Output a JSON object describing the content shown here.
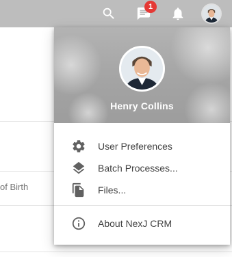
{
  "topbar": {
    "icons": [
      "search-icon",
      "chat-icon",
      "bell-icon"
    ],
    "notification_count": "1",
    "bg_color": "#bdbdbd",
    "badge_color": "#e53935"
  },
  "background": {
    "column_label": "of Birth"
  },
  "user_menu": {
    "user_name": "Henry Collins",
    "items": [
      {
        "label": "User Preferences",
        "icon": "gear-icon"
      },
      {
        "label": "Batch Processes...",
        "icon": "layers-icon"
      },
      {
        "label": "Files...",
        "icon": "file-icon"
      },
      {
        "label": "About NexJ CRM",
        "icon": "info-icon"
      }
    ]
  }
}
